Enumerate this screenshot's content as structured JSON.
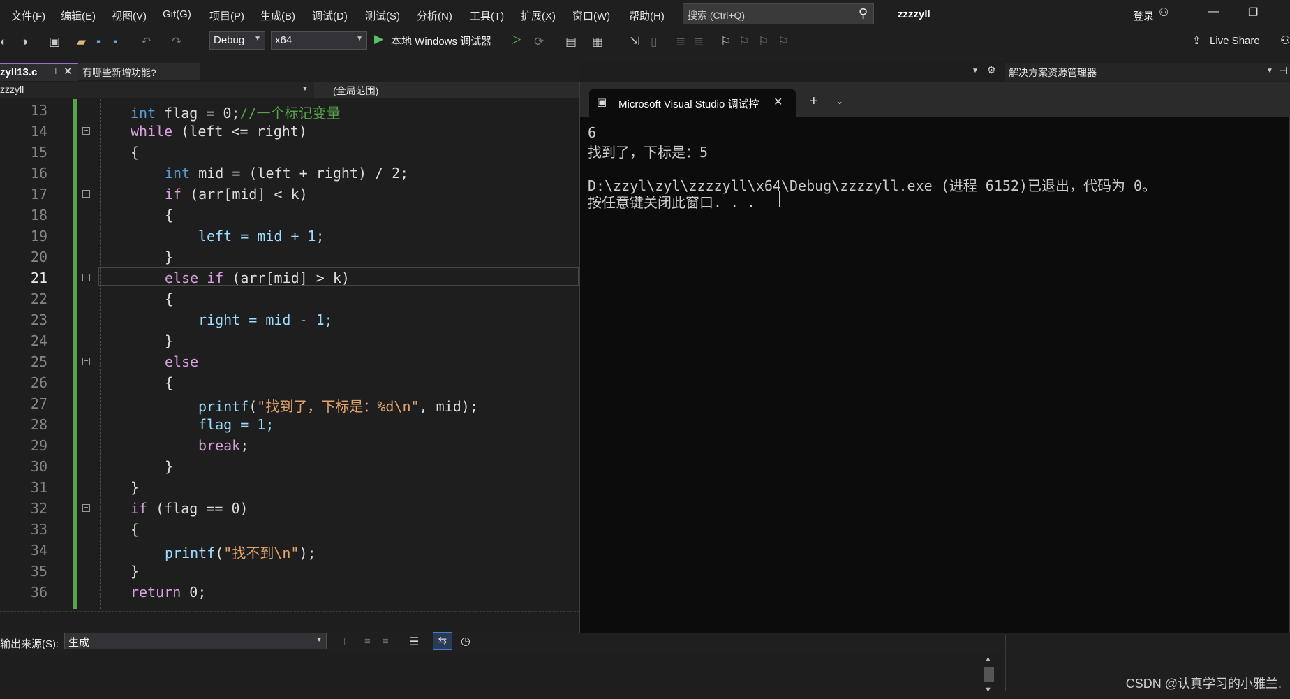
{
  "menu": [
    "文件(F)",
    "编辑(E)",
    "视图(V)",
    "Git(G)",
    "项目(P)",
    "生成(B)",
    "调试(D)",
    "测试(S)",
    "分析(N)",
    "工具(T)",
    "扩展(X)",
    "窗口(W)",
    "帮助(H)"
  ],
  "search": {
    "placeholder": "搜索 (Ctrl+Q)"
  },
  "solution_name": "zzzzyll",
  "login": "登录",
  "toolbar": {
    "config": "Debug",
    "platform": "x64",
    "run_label": "本地 Windows 调试器",
    "live_share": "Live Share"
  },
  "tabs": {
    "active": "zyll13.c",
    "whatsnew": "有哪些新增功能?"
  },
  "navbar": {
    "project": "zzzyll",
    "scope": "(全局范围)"
  },
  "editor": {
    "lines": [
      {
        "n": "13"
      },
      {
        "n": "14"
      },
      {
        "n": "15"
      },
      {
        "n": "16"
      },
      {
        "n": "17"
      },
      {
        "n": "18"
      },
      {
        "n": "19"
      },
      {
        "n": "20"
      },
      {
        "n": "21"
      },
      {
        "n": "22"
      },
      {
        "n": "23"
      },
      {
        "n": "24"
      },
      {
        "n": "25"
      },
      {
        "n": "26"
      },
      {
        "n": "27"
      },
      {
        "n": "28"
      },
      {
        "n": "29"
      },
      {
        "n": "30"
      },
      {
        "n": "31"
      },
      {
        "n": "32"
      },
      {
        "n": "33"
      },
      {
        "n": "34"
      },
      {
        "n": "35"
      },
      {
        "n": "36"
      }
    ],
    "code": {
      "l13_kw": "int",
      "l13_rest": " flag = 0;",
      "l13_cm": "//一个标记变量",
      "l14_kw": "while",
      "l14_rest": " (left <= right)",
      "l15": "{",
      "l16_kw": "int",
      "l16_rest": " mid = (left + right) / 2;",
      "l17_kw": "if",
      "l17_rest": " (arr[mid] < k)",
      "l18": "{",
      "l19": "left = mid + 1;",
      "l20": "}",
      "l21_kw": "else if",
      "l21_rest": " (arr[mid] > k)",
      "l22": "{",
      "l23": "right = mid - 1;",
      "l24": "}",
      "l25_kw": "else",
      "l26": "{",
      "l27_fn": "printf",
      "l27_open": "(",
      "l27_str": "\"找到了，下标是：%d\\n\"",
      "l27_rest": ", mid);",
      "l28": "flag = 1;",
      "l29_kw": "break",
      "l29_rest": ";",
      "l30": "}",
      "l31": "}",
      "l32_kw": "if",
      "l32_rest": " (flag == 0)",
      "l33": "{",
      "l34_fn": "printf",
      "l34_open": "(",
      "l34_str": "\"找不到\\n\"",
      "l34_rest": ");",
      "l35": "}",
      "l36_kw": "return",
      "l36_rest": " 0;"
    }
  },
  "output": {
    "source_label": "输出来源(S):",
    "source_value": "生成"
  },
  "solution_explorer": {
    "title": "解决方案资源管理器"
  },
  "console": {
    "tab_title": "Microsoft Visual Studio 调试控",
    "lines": [
      "6",
      "找到了，下标是：5",
      "",
      "D:\\zzyl\\zyl\\zzzzyll\\x64\\Debug\\zzzzyll.exe (进程 6152)已退出，代码为 0。",
      "按任意键关闭此窗口. . ."
    ]
  },
  "watermark": "CSDN @认真学习的小雅兰."
}
